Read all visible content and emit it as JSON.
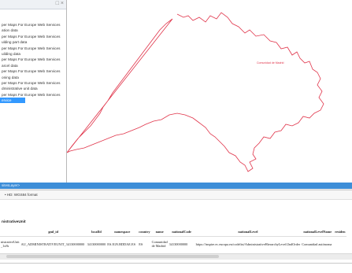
{
  "layer_panel": {
    "layers": [
      {
        "label": "per Maps For Europe Web Services"
      },
      {
        "label": "ation data"
      },
      {
        "label": "per Maps For Europe Web Services"
      },
      {
        "label": "ulding part data"
      },
      {
        "label": "per Maps For Europe Web Services"
      },
      {
        "label": "uilding data"
      },
      {
        "label": "per Maps For Europe Web Services"
      },
      {
        "label": "arcel data"
      },
      {
        "label": "per Maps For Europe Web Services"
      },
      {
        "label": "oning data"
      },
      {
        "label": "per Maps For Europe Web Services"
      },
      {
        "label": "dministrative unit data"
      },
      {
        "label": "per Maps For Europe Web Services"
      },
      {
        "label": "ervice",
        "selected": true
      }
    ]
  },
  "map": {
    "boundary_color": "#e0344a",
    "label": "Comunidad de Madrid"
  },
  "status_bar": {
    "text": "sitesLayer>"
  },
  "results": {
    "toolbar_text": "• HD: WGS84 format",
    "section_title": "nistrativeUnit",
    "columns": [
      "",
      "gml_id",
      "localId",
      "namespace",
      "country",
      "name",
      "nationalCode",
      "nationalLevel",
      "nationalLevelName",
      "residen"
    ],
    "row": [
      "nistrativeUnit\n_1x8s",
      "AU_ADMINISTRATIVEUNIT_34130000000",
      "34130000000",
      "ES.IGN.BDDAE.ES",
      "ES",
      "Comunidad de Madrid",
      "34130000000",
      "https://inspire.ec.europa.eu/codelist/AdministrativeHierarchyLevel/2ndOrder",
      "Comunidad autónoma",
      ""
    ]
  }
}
